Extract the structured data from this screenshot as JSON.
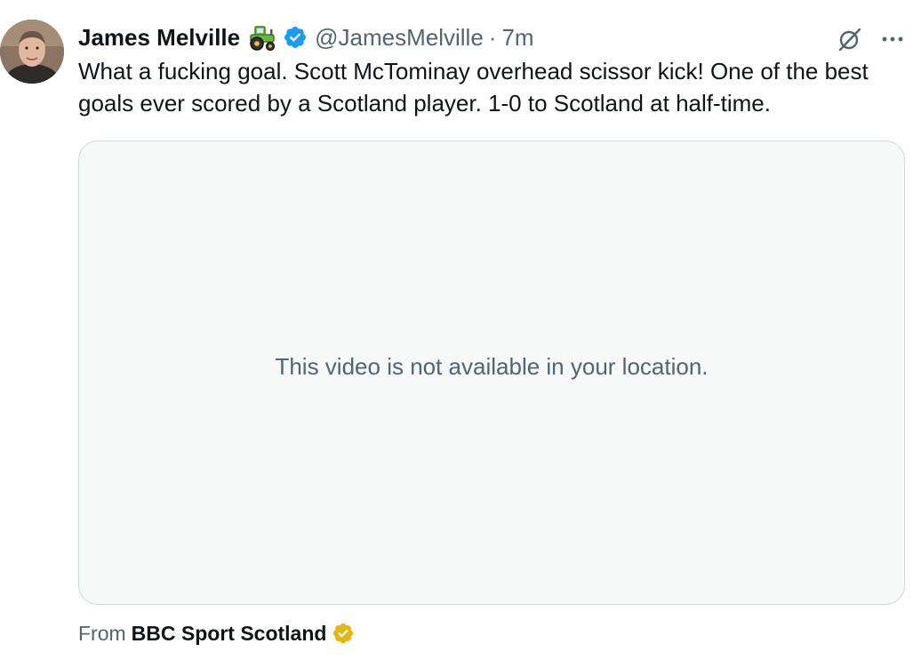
{
  "author": {
    "display_name": "James Melville",
    "emoji_icon": "tractor-icon",
    "verified_badge": "blue-verified-icon",
    "handle": "@JamesMelville",
    "separator": "·",
    "time_ago": "7m"
  },
  "actions": {
    "grok_icon": "grok-icon",
    "more_icon": "more-options-icon"
  },
  "tweet": {
    "text": "What a fucking goal. Scott McTominay overhead scissor kick! One of the best goals ever scored by a Scotland player. 1-0 to Scotland at half-time."
  },
  "media": {
    "message": "This video is not available in your location."
  },
  "attribution": {
    "from_label": "From",
    "source": "BBC Sport Scotland",
    "badge": "gold-verified-icon"
  },
  "colors": {
    "text_primary": "#0f1419",
    "text_secondary": "#536471",
    "verified_blue": "#1d9bf0",
    "verified_gold": "#e2b719",
    "card_background": "#f7f9f9",
    "card_border": "#cfd9de"
  }
}
